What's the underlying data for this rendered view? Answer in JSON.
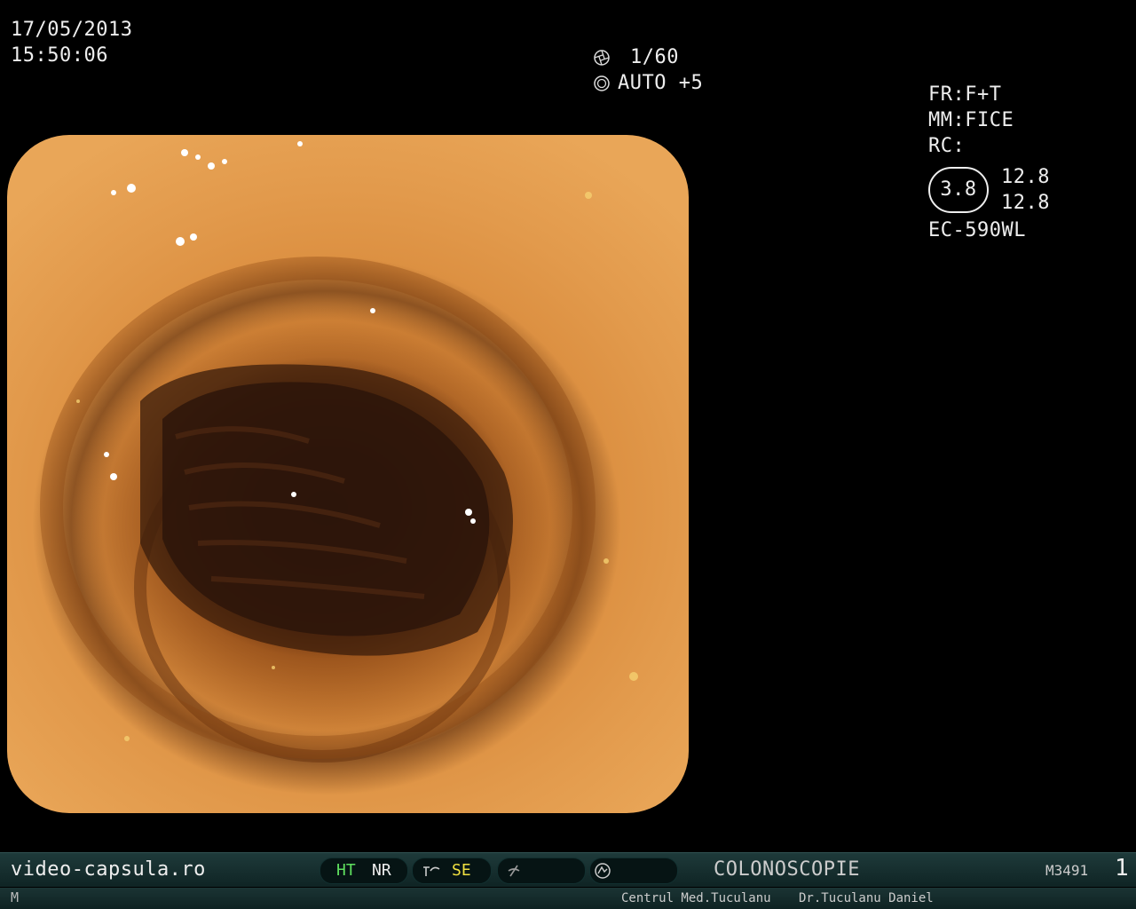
{
  "datetime": {
    "date": "17/05/2013",
    "time": "15:50:06"
  },
  "exposure": {
    "shutter": "1/60",
    "iris": "AUTO +5",
    "shutter_icon": "shutter-icon",
    "iris_icon": "iris-icon"
  },
  "settings": {
    "fr": "FR:F+T",
    "mm": "MM:FICE",
    "rc": "RC:",
    "circle_value": "3.8",
    "value_top": "12.8",
    "value_bottom": "12.8",
    "scope_model": "EC-590WL"
  },
  "status_bar": {
    "website": "video-capsula.ro",
    "ht": "HT",
    "nr": "NR",
    "se": "SE",
    "procedure": "COLONOSCOPIE",
    "code": "M3491",
    "number": "1",
    "icons": [
      "enhancement-icon",
      "freeze-icon",
      "record-icon"
    ]
  },
  "info_bar": {
    "mode": "M",
    "clinic": "Centrul Med.Tuculanu",
    "doctor": "Dr.Tuculanu Daniel"
  },
  "colors": {
    "ht": "#5fe05f",
    "se": "#f0e040",
    "bar": "#16302f"
  }
}
